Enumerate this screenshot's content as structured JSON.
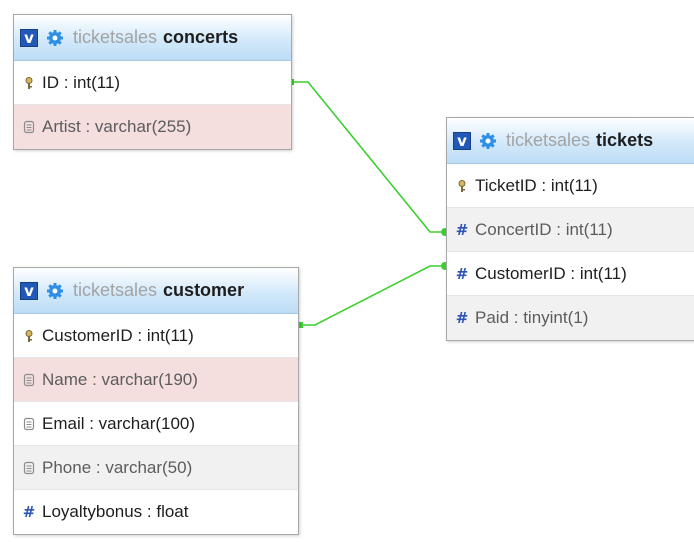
{
  "colors": {
    "connector": "#3ccf2e",
    "toggle_bg": "#2259b9",
    "gear": "#2e8fe6",
    "db_name": "#a3a3a3",
    "row_pink": "#f4dede",
    "row_gray": "#f1f1f1"
  },
  "icons": {
    "toggle": "v",
    "gear": "gear-icon",
    "primary_key": "key-icon",
    "text_column": "text-column-icon",
    "numeric_column": "#"
  },
  "tables": {
    "concerts": {
      "db": "ticketsales",
      "name": "concerts",
      "columns": [
        {
          "label": "ID : int(11)",
          "type": "primary_key"
        },
        {
          "label": "Artist : varchar(255)",
          "type": "text"
        }
      ]
    },
    "tickets": {
      "db": "ticketsales",
      "name": "tickets",
      "columns": [
        {
          "label": "TicketID : int(11)",
          "type": "primary_key"
        },
        {
          "label": "ConcertID : int(11)",
          "type": "numeric"
        },
        {
          "label": "CustomerID : int(11)",
          "type": "numeric"
        },
        {
          "label": "Paid : tinyint(1)",
          "type": "numeric"
        }
      ]
    },
    "customer": {
      "db": "ticketsales",
      "name": "customer",
      "columns": [
        {
          "label": "CustomerID : int(11)",
          "type": "primary_key"
        },
        {
          "label": "Name : varchar(190)",
          "type": "text"
        },
        {
          "label": "Email : varchar(100)",
          "type": "text"
        },
        {
          "label": "Phone : varchar(50)",
          "type": "text"
        },
        {
          "label": "Loyaltybonus : float",
          "type": "numeric"
        }
      ]
    }
  },
  "relations": [
    {
      "from": "concerts.ID",
      "to": "tickets.ConcertID"
    },
    {
      "from": "customer.CustomerID",
      "to": "tickets.CustomerID"
    }
  ]
}
